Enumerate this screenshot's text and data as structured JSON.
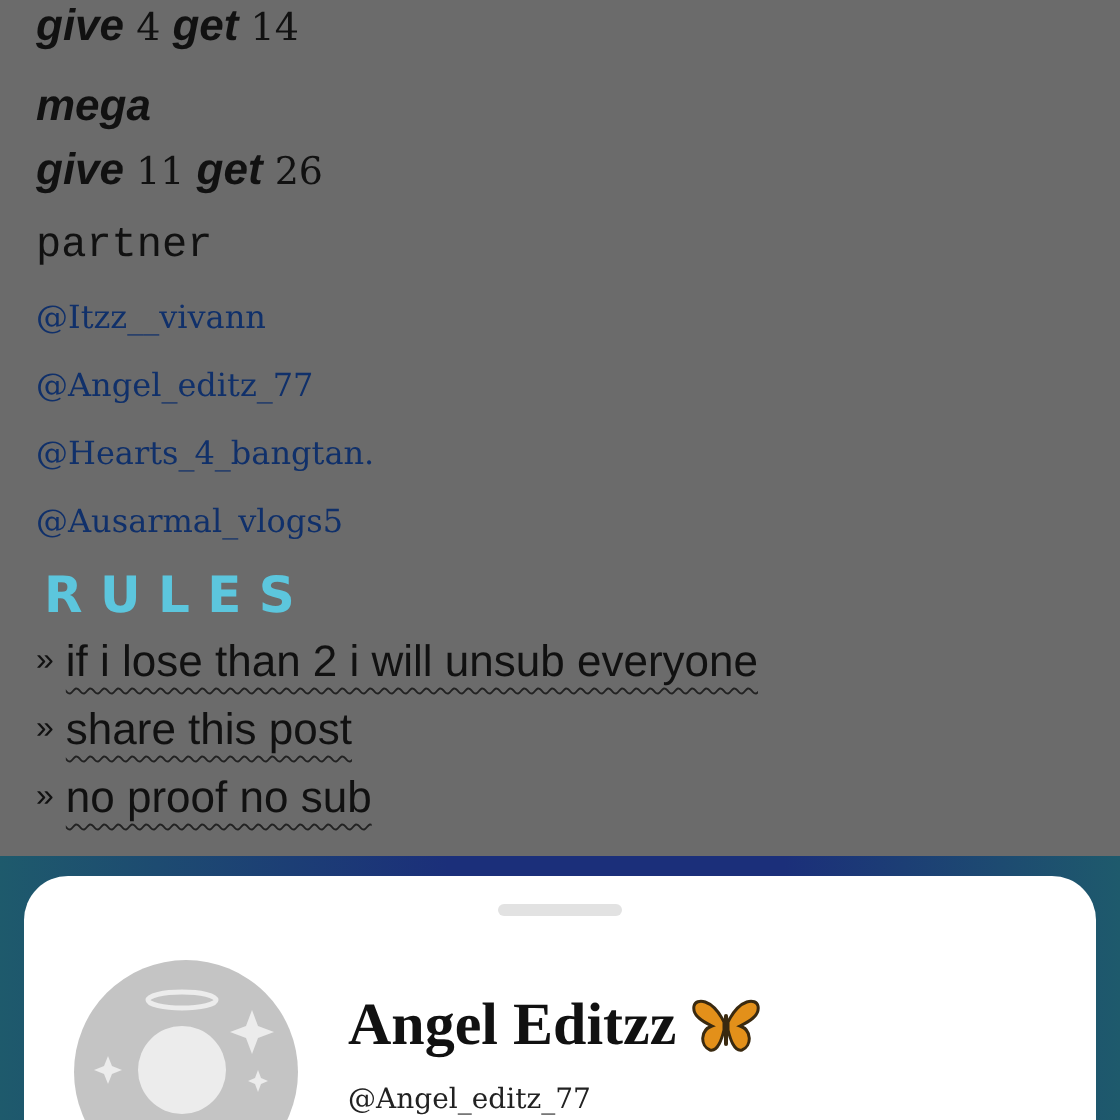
{
  "post_lines": [
    {
      "kind": "offer",
      "text": "**give** 4 **get** 14"
    },
    {
      "kind": "heading",
      "text": "mega"
    },
    {
      "kind": "offer",
      "text": "**give** 11 **get** 26"
    },
    {
      "kind": "label",
      "text": "partner"
    },
    {
      "kind": "mention",
      "text": "@Itzz__vivann"
    },
    {
      "kind": "mention",
      "text": "@Angel_editz_77"
    },
    {
      "kind": "mention",
      "text": "@Hearts_4_bangtan."
    },
    {
      "kind": "mention",
      "text": "@Ausarmal_vlogs5"
    },
    {
      "kind": "rules_title",
      "text": "R U L E S"
    }
  ],
  "rules": [
    {
      "bullet": "»",
      "text": "if i lose than 2 i will unsub everyone"
    },
    {
      "bullet": "»",
      "text": "share this post"
    },
    {
      "bullet": "»",
      "text": "no proof no sub"
    }
  ],
  "profile_sheet": {
    "name": "Angel Editzz",
    "handle": "@Angel_editz_77"
  }
}
